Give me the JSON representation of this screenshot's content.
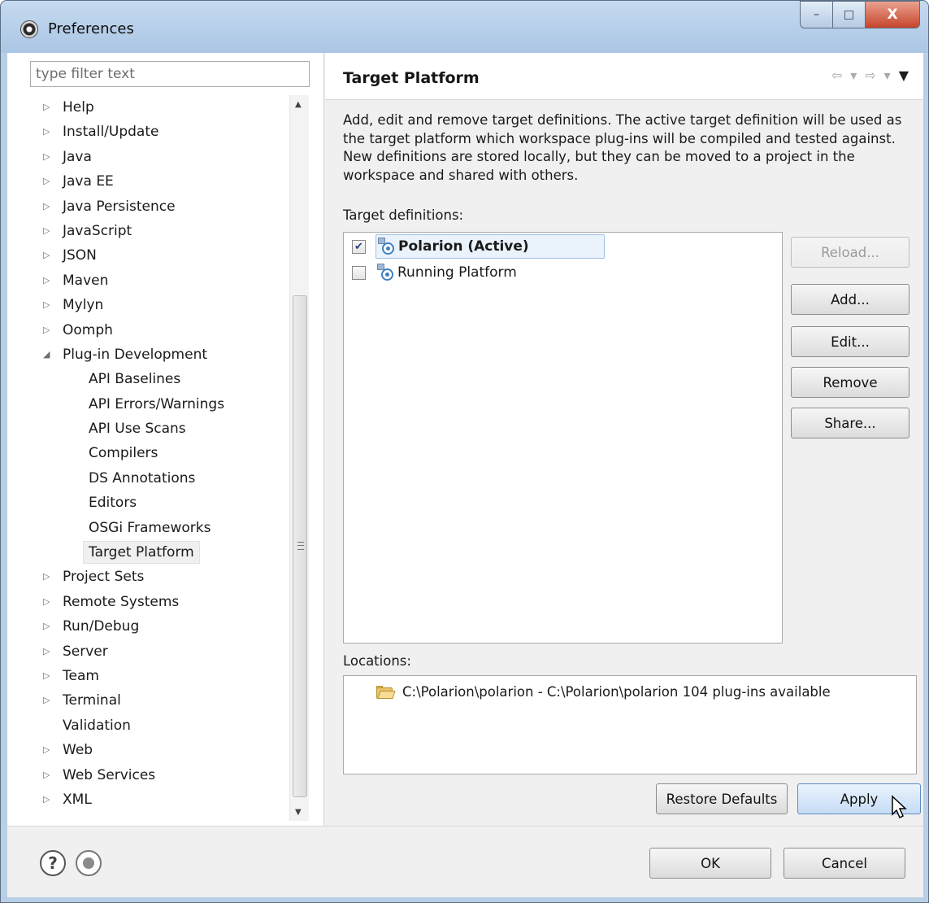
{
  "window": {
    "title": "Preferences",
    "icon": "gear-icon",
    "controls": {
      "minimize": "–",
      "maximize": "□",
      "close": "X"
    }
  },
  "sidebar": {
    "filter_placeholder": "type filter text",
    "tree": [
      {
        "label": "Help",
        "expandable": true,
        "expanded": false,
        "level": 0
      },
      {
        "label": "Install/Update",
        "expandable": true,
        "expanded": false,
        "level": 0
      },
      {
        "label": "Java",
        "expandable": true,
        "expanded": false,
        "level": 0
      },
      {
        "label": "Java EE",
        "expandable": true,
        "expanded": false,
        "level": 0
      },
      {
        "label": "Java Persistence",
        "expandable": true,
        "expanded": false,
        "level": 0
      },
      {
        "label": "JavaScript",
        "expandable": true,
        "expanded": false,
        "level": 0
      },
      {
        "label": "JSON",
        "expandable": true,
        "expanded": false,
        "level": 0
      },
      {
        "label": "Maven",
        "expandable": true,
        "expanded": false,
        "level": 0
      },
      {
        "label": "Mylyn",
        "expandable": true,
        "expanded": false,
        "level": 0
      },
      {
        "label": "Oomph",
        "expandable": true,
        "expanded": false,
        "level": 0
      },
      {
        "label": "Plug-in Development",
        "expandable": true,
        "expanded": true,
        "level": 0
      },
      {
        "label": "API Baselines",
        "expandable": false,
        "level": 1
      },
      {
        "label": "API Errors/Warnings",
        "expandable": false,
        "level": 1
      },
      {
        "label": "API Use Scans",
        "expandable": false,
        "level": 1
      },
      {
        "label": "Compilers",
        "expandable": false,
        "level": 1
      },
      {
        "label": "DS Annotations",
        "expandable": false,
        "level": 1
      },
      {
        "label": "Editors",
        "expandable": false,
        "level": 1
      },
      {
        "label": "OSGi Frameworks",
        "expandable": false,
        "level": 1
      },
      {
        "label": "Target Platform",
        "expandable": false,
        "level": 1,
        "selected": true
      },
      {
        "label": "Project Sets",
        "expandable": true,
        "expanded": false,
        "level": 0
      },
      {
        "label": "Remote Systems",
        "expandable": true,
        "expanded": false,
        "level": 0
      },
      {
        "label": "Run/Debug",
        "expandable": true,
        "expanded": false,
        "level": 0
      },
      {
        "label": "Server",
        "expandable": true,
        "expanded": false,
        "level": 0
      },
      {
        "label": "Team",
        "expandable": true,
        "expanded": false,
        "level": 0
      },
      {
        "label": "Terminal",
        "expandable": true,
        "expanded": false,
        "level": 0
      },
      {
        "label": "Validation",
        "expandable": false,
        "level": 0
      },
      {
        "label": "Web",
        "expandable": true,
        "expanded": false,
        "level": 0
      },
      {
        "label": "Web Services",
        "expandable": true,
        "expanded": false,
        "level": 0
      },
      {
        "label": "XML",
        "expandable": true,
        "expanded": false,
        "level": 0
      }
    ]
  },
  "page": {
    "title": "Target Platform",
    "description": "Add, edit and remove target definitions.  The active target definition will be used as the target platform which workspace plug-ins will be compiled and tested against.  New definitions are stored locally, but they can be moved to a project in the workspace and shared with others.",
    "definitions_label": "Target definitions:",
    "definitions": [
      {
        "name": "Polarion (Active)",
        "checked": true,
        "selected": true,
        "icon": "target-definition-icon"
      },
      {
        "name": "Running Platform",
        "checked": false,
        "selected": false,
        "icon": "target-definition-icon"
      }
    ],
    "buttons": {
      "reload": "Reload...",
      "add": "Add...",
      "edit": "Edit...",
      "remove": "Remove",
      "share": "Share..."
    },
    "locations_label": "Locations:",
    "locations": [
      {
        "text": "C:\\Polarion\\polarion - C:\\Polarion\\polarion 104 plug-ins available",
        "icon": "folder-open-icon"
      }
    ],
    "restore_defaults": "Restore Defaults",
    "apply": "Apply"
  },
  "footer": {
    "ok": "OK",
    "cancel": "Cancel"
  },
  "colors": {
    "accent": "#3f7fbf",
    "selection": "#eaf2fc",
    "frame": "#b9cfe6"
  }
}
